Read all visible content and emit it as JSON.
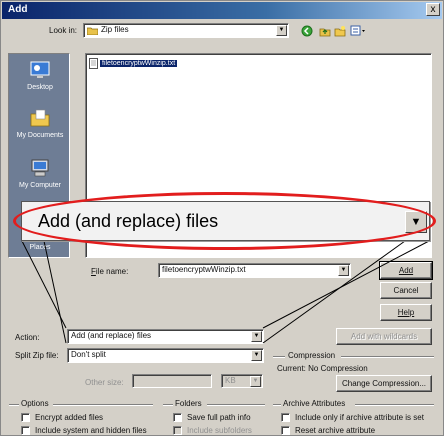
{
  "window": {
    "title": "Add",
    "close_glyph": "x"
  },
  "look_in": {
    "label": "Look in:",
    "value": "Zip files"
  },
  "toolbar_icons": [
    "back-green-icon",
    "up-folder-icon",
    "new-folder-icon",
    "view-menu-icon"
  ],
  "file_list": {
    "items": [
      "filetoencryptwWinzip.txt"
    ]
  },
  "places": [
    {
      "label": "Desktop",
      "icon": "desktop-icon"
    },
    {
      "label": "My Documents",
      "icon": "my-documents-icon"
    },
    {
      "label": "My Computer",
      "icon": "my-computer-icon"
    },
    {
      "label": "Places",
      "icon": "network-places-icon"
    }
  ],
  "filename": {
    "label": "File name:",
    "value": "filetoencryptwWinzip.txt"
  },
  "buttons": {
    "add": "Add",
    "cancel": "Cancel",
    "help": "Help",
    "add_wildcards": "Add with wildcards",
    "change_compression": "Change Compression..."
  },
  "action": {
    "label": "Action:",
    "value": "Add (and replace) files"
  },
  "split": {
    "label": "Split Zip file:",
    "value": "Don't split"
  },
  "other_size": {
    "label": "Other size:",
    "unit": "KB"
  },
  "compression": {
    "title": "Compression",
    "current": "Current: No Compression"
  },
  "options": {
    "title": "Options",
    "encrypt": "Encrypt added files",
    "include_system": "Include system and hidden files"
  },
  "folders": {
    "title": "Folders",
    "save_full_path": "Save full path info",
    "include_subfolders": "Include subfolders"
  },
  "archive_attributes": {
    "title": "Archive Attributes",
    "include_only": "Include only if archive attribute is set",
    "reset": "Reset archive attribute"
  },
  "highlight": {
    "text": "Add (and replace) files",
    "color": "#e21d1d"
  }
}
